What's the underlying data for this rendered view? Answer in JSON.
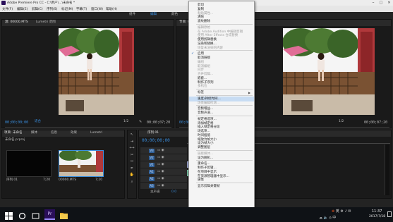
{
  "window": {
    "title": "Adobe Premiere Pro CC - C:\\用户\\...\\未命名 *"
  },
  "menubar": [
    "文件(F)",
    "编辑(E)",
    "剪辑(C)",
    "序列(S)",
    "标记(M)",
    "字幕(T)",
    "窗口(W)",
    "帮助(H)"
  ],
  "workspace_tabs": [
    "组件",
    "编辑",
    "颜色",
    "效果",
    "音频"
  ],
  "source_panel": {
    "tab": "源: 00000.MTS",
    "tab2": "Lumetri 范围",
    "timecode": "00;00;00;00",
    "fit": "适合",
    "fraction": "1/2",
    "duration": "00;00;07;20"
  },
  "program_panel": {
    "tab": "节目: 00000",
    "timecode": "00;00;00;00",
    "fraction": "1/2",
    "duration": "00;00;07;20"
  },
  "project_panel": {
    "tabs": [
      "项目: 未命名",
      "媒体",
      "信息",
      "效果",
      "Lumetri"
    ],
    "file": "未命名.prproj",
    "items": [
      {
        "name": "序列 01",
        "duration": "7;20"
      },
      {
        "name": "00000.MTS",
        "duration": "7;20"
      }
    ]
  },
  "timeline_panel": {
    "tab": "序列 01",
    "timecode": "00;00;00;00",
    "video_tracks": [
      "V3",
      "V2",
      "V1"
    ],
    "audio_tracks": [
      "A1",
      "A2",
      "A3"
    ],
    "master": "主声道",
    "master_value": "0.0"
  },
  "context_menu": {
    "items": [
      {
        "label": "剪切",
        "state": "normal"
      },
      {
        "label": "复制",
        "state": "normal"
      },
      {
        "label": "粘贴属性...",
        "state": "disabled"
      },
      {
        "label": "清除",
        "state": "normal"
      },
      {
        "label": "波纹删除",
        "state": "normal"
      },
      {
        "sep": true
      },
      {
        "label": "编辑原始",
        "state": "disabled"
      },
      {
        "label": "在 Adobe Audition 中编辑剪辑",
        "state": "disabled"
      },
      {
        "label": "使用 After Effects 合成替换",
        "state": "disabled"
      },
      {
        "label": "使用剪辑替换",
        "state": "normal"
      },
      {
        "label": "渲染和替换...",
        "state": "normal"
      },
      {
        "label": "恢复未渲染的内容",
        "state": "disabled"
      },
      {
        "sep": true
      },
      {
        "label": "启用",
        "state": "checked"
      },
      {
        "label": "取消链接",
        "state": "normal"
      },
      {
        "label": "编组",
        "state": "disabled"
      },
      {
        "label": "取消编组",
        "state": "disabled"
      },
      {
        "label": "同步",
        "state": "disabled"
      },
      {
        "label": "合并剪辑...",
        "state": "disabled"
      },
      {
        "label": "嵌套...",
        "state": "normal"
      },
      {
        "label": "制作子序列",
        "state": "normal"
      },
      {
        "label": "多机位",
        "state": "disabled"
      },
      {
        "sep": true
      },
      {
        "label": "标签",
        "state": "normal"
      },
      {
        "sep": true
      },
      {
        "label": "速度/持续时间...",
        "state": "highlight"
      },
      {
        "label": "场景编辑检测...",
        "state": "disabled"
      },
      {
        "sep": true
      },
      {
        "label": "音频增益...",
        "state": "normal"
      },
      {
        "label": "音频声道...",
        "state": "normal"
      },
      {
        "sep": true
      },
      {
        "label": "帧定格选项...",
        "state": "normal"
      },
      {
        "label": "添加帧定格",
        "state": "normal"
      },
      {
        "label": "插入帧定格分段",
        "state": "normal"
      },
      {
        "label": "场选项...",
        "state": "normal"
      },
      {
        "label": "时间插值",
        "state": "normal"
      },
      {
        "label": "缩放为帧大小",
        "state": "normal"
      },
      {
        "label": "设为帧大小",
        "state": "normal"
      },
      {
        "label": "调整图层",
        "state": "normal"
      },
      {
        "sep": true
      },
      {
        "label": "链接媒体...",
        "state": "disabled"
      },
      {
        "label": "设为脱机...",
        "state": "normal"
      },
      {
        "sep": true
      },
      {
        "label": "重命名...",
        "state": "normal"
      },
      {
        "label": "制作子剪辑...",
        "state": "normal"
      },
      {
        "label": "在项目中显示",
        "state": "normal"
      },
      {
        "label": "在资源管理器中显示...",
        "state": "normal"
      },
      {
        "label": "属性",
        "state": "normal"
      },
      {
        "sep": true
      },
      {
        "label": "显示剪辑关键帧",
        "state": "normal"
      }
    ]
  },
  "taskbar": {
    "time": "11:37",
    "date": "2017/7/18",
    "ime": "中",
    "ime2": "英"
  }
}
